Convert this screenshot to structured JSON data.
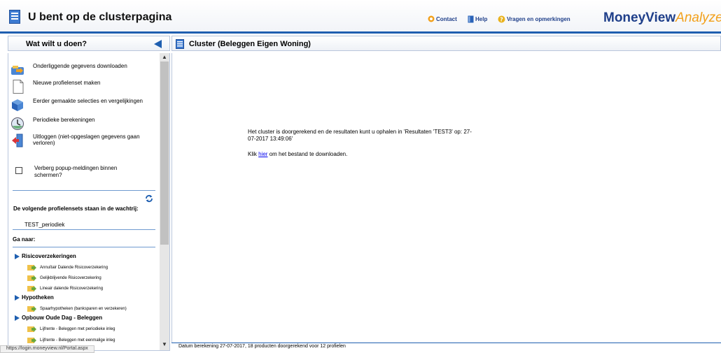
{
  "header": {
    "title": "U bent op de clusterpagina",
    "contact": "Contact",
    "help": "Help",
    "feedback": "Vragen en opmerkingen",
    "brand_part1": "MoneyView",
    "brand_part2": "Analyzer"
  },
  "sidebar": {
    "title": "Wat wilt u doen?",
    "actions": [
      {
        "label": "Onderliggende gegevens downloaden",
        "icon": "download-icon"
      },
      {
        "label": "Nieuwe profielenset maken",
        "icon": "new-document-icon"
      },
      {
        "label": "Eerder gemaakte selecties en vergelijkingen",
        "icon": "selections-icon"
      },
      {
        "label": "Periodieke berekeningen",
        "icon": "clock-icon"
      },
      {
        "label": "Uitloggen (niet-opgeslagen gegevens gaan verloren)",
        "icon": "logout-icon"
      }
    ],
    "popup_checkbox_label": "Verberg popup-meldingen binnen schermen?",
    "queue_heading": "De volgende profielensets staan in de wachtrij:",
    "queue_items": [
      "TEST_periodiek"
    ],
    "goto_heading": "Ga naar:",
    "categories": [
      {
        "label": "Risicoverzekeringen",
        "items": [
          "Annuïtair Dalende Risicoverzekering",
          "Gelijkblijvende Risicoverzekering",
          "Lineair dalende Risicoverzekering"
        ]
      },
      {
        "label": "Hypotheken",
        "items": [
          "Spaarhypotheken (banksparen en verzekeren)"
        ]
      },
      {
        "label": "Opbouw Oude Dag - Beleggen",
        "items": [
          "Lijfrente - Beleggen met periodieke inleg",
          "Lijfrente - Beleggen met eenmalige inleg"
        ]
      }
    ]
  },
  "main": {
    "title": "Cluster (Beleggen Eigen Woning)",
    "message": "Het cluster is doorgerekend en de resultaten kunt u ophalen in 'Resultaten 'TEST3' op: 27-07-2017 13:49:06'",
    "download_prefix": "Klik",
    "download_link": "hier",
    "download_suffix": "om het bestand te downloaden.",
    "footer": "Datum berekening 27-07-2017, 18 producten doorgerekend voor 12 profielen"
  },
  "statusbar": {
    "url": "https://login.moneyview.nl/Portal.aspx"
  },
  "colors": {
    "accent": "#1f5fb0",
    "brand_blue": "#1f3f8a",
    "brand_orange": "#f2a01a"
  }
}
